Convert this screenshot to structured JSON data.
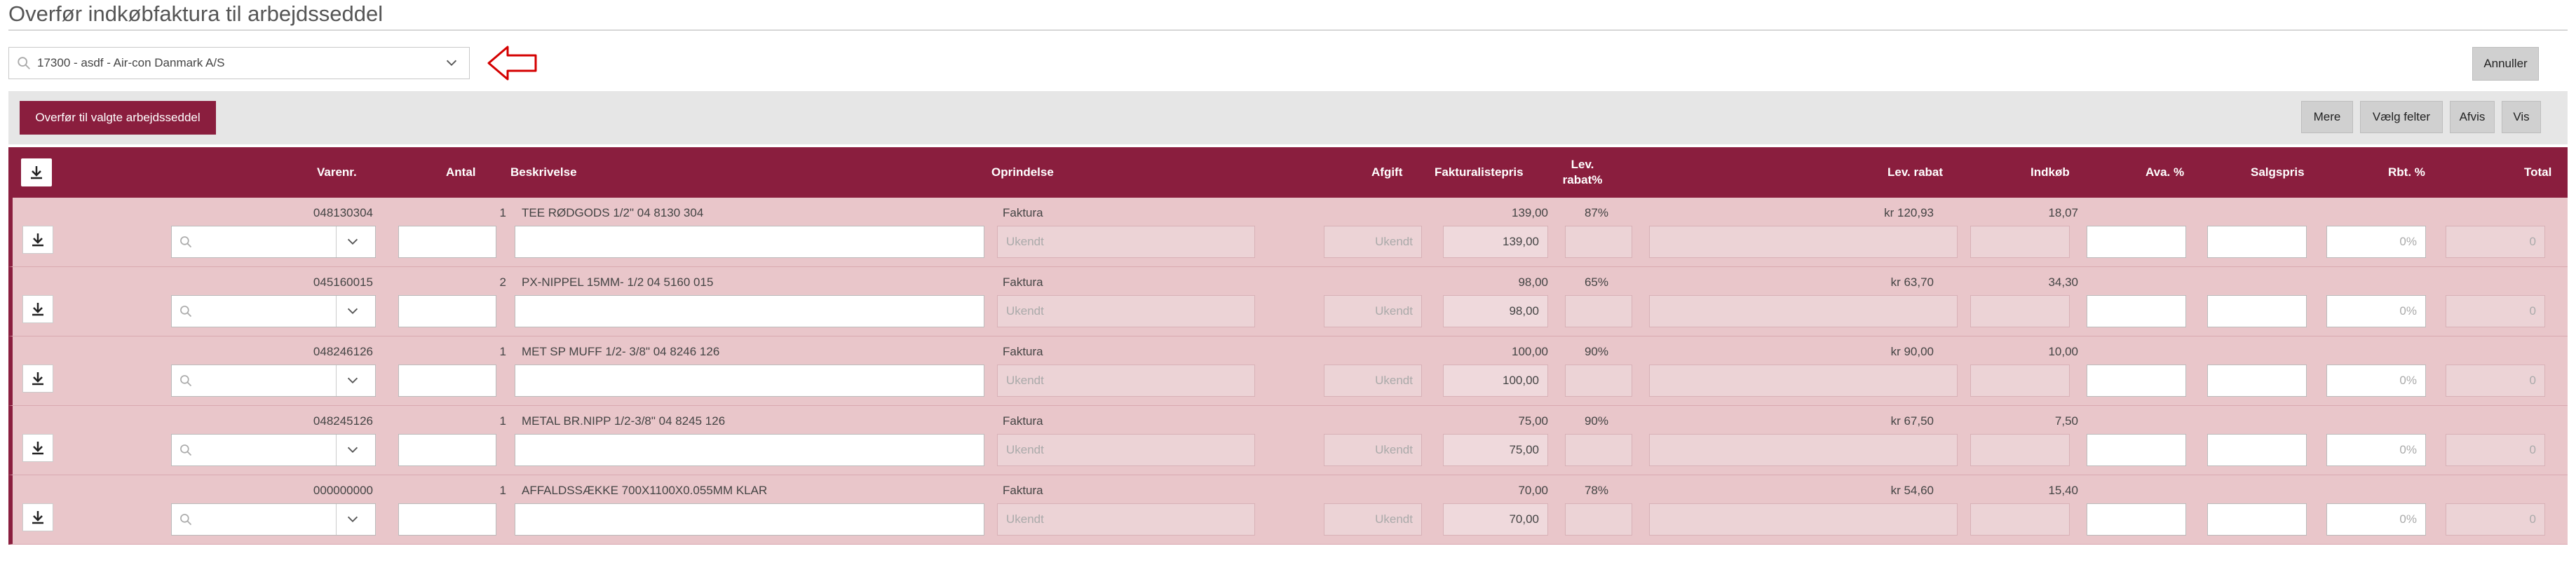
{
  "page_title": "Overfør indkøbfaktura til arbejdsseddel",
  "supplier_select": {
    "value": "17300 - asdf - Air-con Danmark A/S"
  },
  "buttons": {
    "annuller": "Annuller",
    "transfer": "Overfør til valgte arbejdsseddel",
    "mere": "Mere",
    "vaelg_felter": "Vælg felter",
    "afvis": "Afvis",
    "vis": "Vis"
  },
  "columns": {
    "varenr": "Varenr.",
    "antal": "Antal",
    "beskrivelse": "Beskrivelse",
    "oprindelse": "Oprindelse",
    "afgift": "Afgift",
    "fakturalistepris": "Fakturalistepris",
    "lev_rabat_pct": "Lev. rabat%",
    "lev_rabat": "Lev. rabat",
    "indkob": "Indkøb",
    "ava_pct": "Ava. %",
    "salgspris": "Salgspris",
    "rbt_pct": "Rbt. %",
    "total": "Total"
  },
  "placeholders": {
    "oprindelse": "Ukendt",
    "afgift": "Ukendt",
    "rbt": "0%",
    "total": "0"
  },
  "rows": [
    {
      "varenr": "048130304",
      "antal": "1",
      "beskrivelse": "TEE RØDGODS 1/2\" 04 8130 304",
      "oprindelse": "Faktura",
      "fakturalistepris": "139,00",
      "listepris_input": "139,00",
      "lev_rabat_pct": "87%",
      "lev_rabat": "kr 120,93",
      "indkob": "18,07"
    },
    {
      "varenr": "045160015",
      "antal": "2",
      "beskrivelse": "PX-NIPPEL 15MM- 1/2 04 5160 015",
      "oprindelse": "Faktura",
      "fakturalistepris": "98,00",
      "listepris_input": "98,00",
      "lev_rabat_pct": "65%",
      "lev_rabat": "kr 63,70",
      "indkob": "34,30"
    },
    {
      "varenr": "048246126",
      "antal": "1",
      "beskrivelse": "MET SP MUFF 1/2- 3/8\" 04 8246 126",
      "oprindelse": "Faktura",
      "fakturalistepris": "100,00",
      "listepris_input": "100,00",
      "lev_rabat_pct": "90%",
      "lev_rabat": "kr 90,00",
      "indkob": "10,00"
    },
    {
      "varenr": "048245126",
      "antal": "1",
      "beskrivelse": "METAL BR.NIPP 1/2-3/8\" 04 8245 126",
      "oprindelse": "Faktura",
      "fakturalistepris": "75,00",
      "listepris_input": "75,00",
      "lev_rabat_pct": "90%",
      "lev_rabat": "kr 67,50",
      "indkob": "7,50"
    },
    {
      "varenr": "000000000",
      "antal": "1",
      "beskrivelse": "AFFALDSSÆKKE 700X1100X0.055MM KLAR",
      "oprindelse": "Faktura",
      "fakturalistepris": "70,00",
      "listepris_input": "70,00",
      "lev_rabat_pct": "78%",
      "lev_rabat": "kr 54,60",
      "indkob": "15,40"
    }
  ],
  "colors": {
    "brand": "#8a1e3e",
    "row_bg": "#e9c6ca",
    "arrow": "#d40000"
  }
}
